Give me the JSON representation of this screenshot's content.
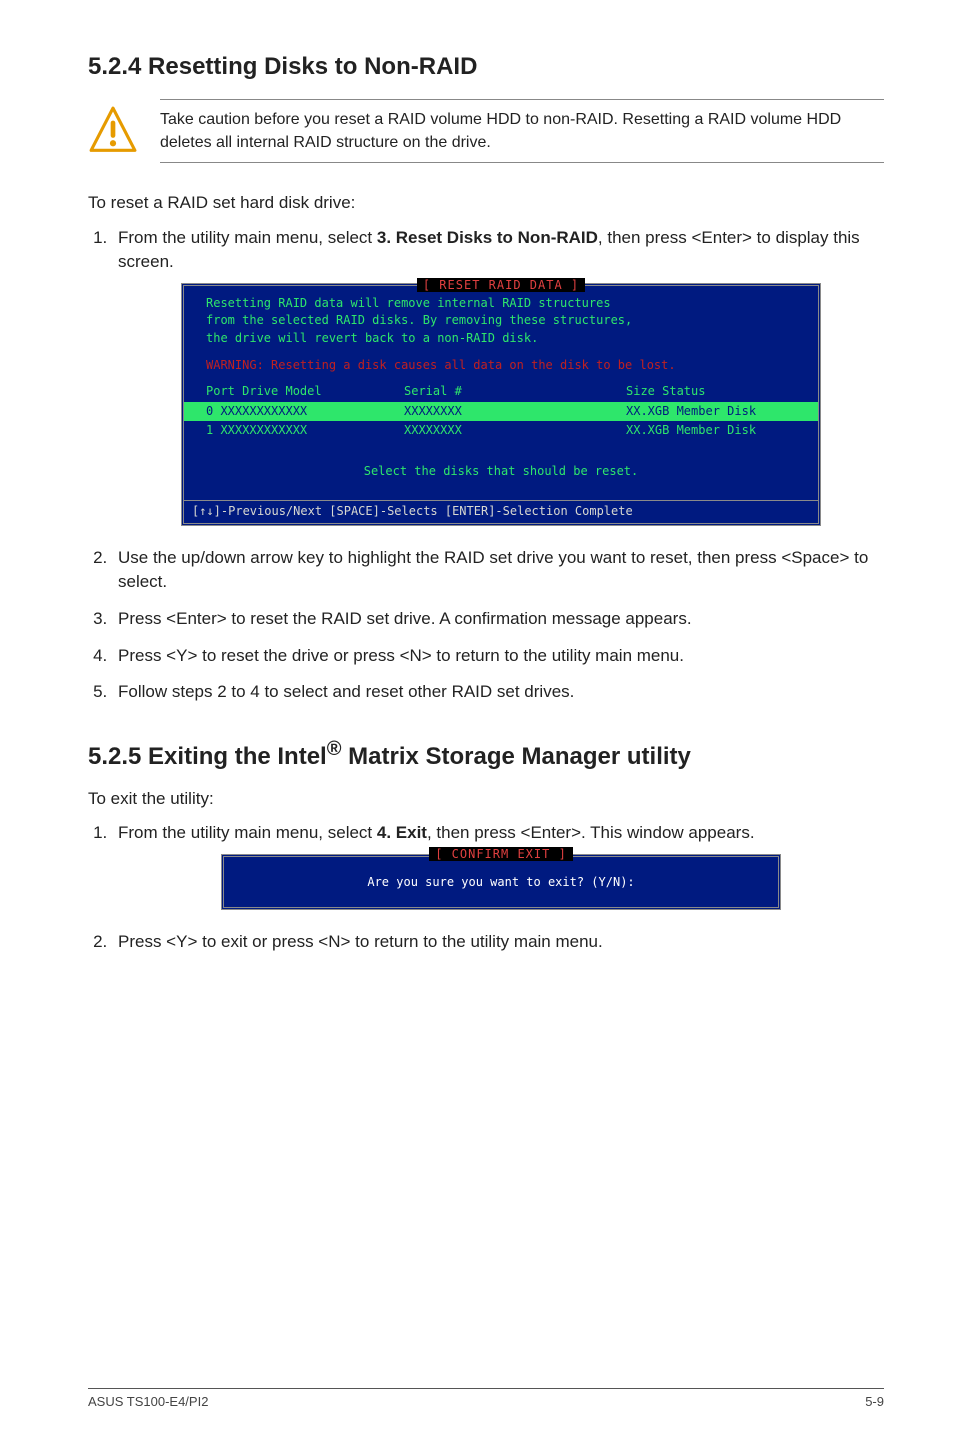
{
  "section_524": {
    "title": "5.2.4 Resetting Disks to Non-RAID",
    "caution": "Take caution before you reset a RAID volume HDD to non-RAID. Resetting a RAID volume HDD deletes all internal RAID structure on the drive.",
    "lead": "To reset a RAID set hard disk drive:",
    "step1_pre": "From the utility main menu, select ",
    "step1_bold": "3. Reset Disks to Non-RAID",
    "step1_post": ", then press <Enter> to display this screen.",
    "step2": "Use the up/down arrow key to highlight the RAID set drive you want to reset, then press <Space> to select.",
    "step3": "Press <Enter> to reset the RAID set drive. A confirmation message appears.",
    "step4": "Press <Y> to reset the drive or press <N> to return to the utility main menu.",
    "step5": "Follow steps 2 to 4 to select and reset other RAID set drives."
  },
  "bios_reset": {
    "title": "[ RESET RAID DATA ]",
    "paragraph": "Resetting RAID data will remove internal RAID structures\nfrom the selected RAID disks. By removing these structures,\nthe drive will revert back to a non-RAID disk.",
    "warning": "WARNING: Resetting a disk causes all data on the disk to be lost.",
    "header": {
      "c1": "Port Drive Model",
      "c2": "Serial #",
      "c3": "Size Status"
    },
    "rows": [
      {
        "c1": "0 XXXXXXXXXXXX",
        "c2": "XXXXXXXX",
        "c3": "XX.XGB Member Disk",
        "selected": true
      },
      {
        "c1": "1 XXXXXXXXXXXX",
        "c2": "XXXXXXXX",
        "c3": "XX.XGB Member Disk",
        "selected": false
      }
    ],
    "note": "Select the disks that should be reset.",
    "footer": "[↑↓]-Previous/Next  [SPACE]-Selects  [ENTER]-Selection Complete"
  },
  "section_525": {
    "title_pre": "5.2.5 Exiting the Intel",
    "title_sup": "®",
    "title_post": " Matrix Storage Manager utility",
    "lead": "To exit the utility:",
    "step1_pre": "From the utility main menu, select ",
    "step1_bold": "4. Exit",
    "step1_post": ", then press <Enter>. This window appears.",
    "step2": "Press <Y> to exit or press <N> to return to the utility main menu."
  },
  "bios_exit": {
    "title": "[ CONFIRM EXIT ]",
    "msg": "Are you sure you want to exit? (Y/N):"
  },
  "footer": {
    "left": "ASUS TS100-E4/PI2",
    "right": "5-9"
  }
}
